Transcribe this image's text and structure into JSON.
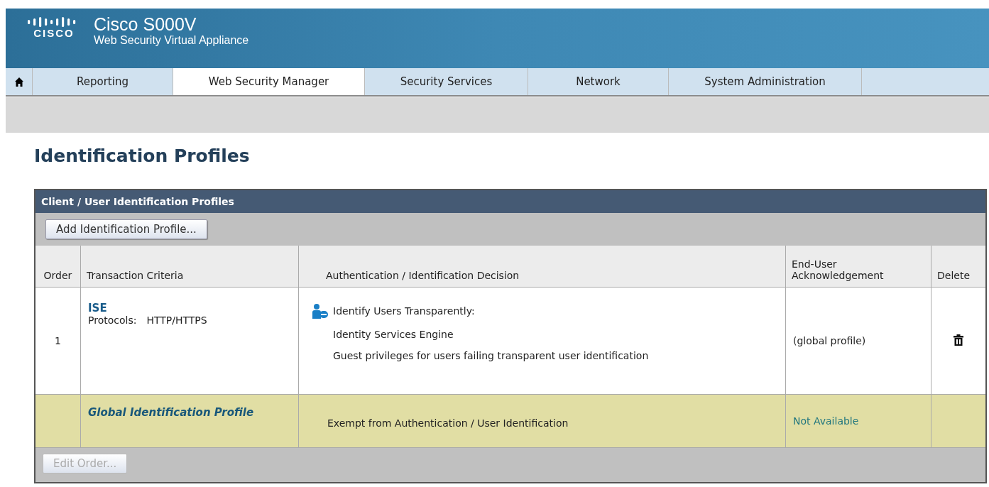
{
  "header": {
    "logo": "CISCO",
    "product": "Cisco S000V",
    "subtitle": "Web Security Virtual Appliance"
  },
  "tabs": [
    {
      "label": "Reporting",
      "selected": false
    },
    {
      "label": "Web Security Manager",
      "selected": true
    },
    {
      "label": "Security Services",
      "selected": false
    },
    {
      "label": "Network",
      "selected": false
    },
    {
      "label": "System Administration",
      "selected": false
    }
  ],
  "page_title": "Identification Profiles",
  "panel": {
    "title": "Client / User Identification Profiles",
    "add_button": {
      "label": "Add Identification Profile...",
      "disabled": false
    },
    "table": {
      "columns": [
        "Order",
        "Transaction Criteria",
        "Authentication / Identification Decision",
        "End-User Acknowledgement",
        "Delete"
      ],
      "rows": [
        {
          "kind": "rule",
          "order": "1",
          "name": "ISE",
          "protocols_label": "Protocols:",
          "protocols": "HTTP/HTTPS",
          "decision": [
            "Identify Users Transparently:",
            "Identity Services Engine",
            "Guest privileges for users failing transparent user identification"
          ],
          "acknowledgement": "(global profile)",
          "deletable": true
        },
        {
          "kind": "global",
          "name": "Global Identification Profile",
          "decision": [
            "Exempt from Authentication / User Identification"
          ],
          "acknowledgement": "Not Available",
          "deletable": false
        }
      ]
    },
    "edit_button": {
      "label": "Edit Order...",
      "disabled": true
    }
  }
}
